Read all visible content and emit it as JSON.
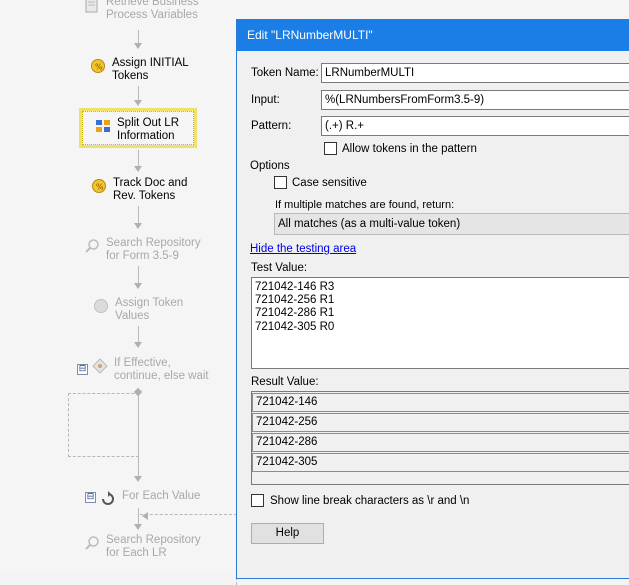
{
  "workflow": {
    "nodes": [
      {
        "label": "Retrieve Business\nProcess Variables",
        "icon": "document-icon"
      },
      {
        "label": "Assign INITIAL\nTokens",
        "icon": "token-icon"
      },
      {
        "label": "Split Out LR\nInformation",
        "icon": "grid-icon"
      },
      {
        "label": "Track Doc and\nRev. Tokens",
        "icon": "token-icon"
      },
      {
        "label": "Search Repository\nfor Form 3.5-9",
        "icon": "search-icon"
      },
      {
        "label": "Assign Token\nValues",
        "icon": "token-icon"
      },
      {
        "label": "If Effective,\ncontinue, else wait",
        "icon": "condition-icon"
      },
      {
        "label": "For Each Value",
        "icon": "loop-icon"
      },
      {
        "label": "Search Repository\nfor Each LR",
        "icon": "search-icon"
      }
    ],
    "collapse_symbol": "⊟"
  },
  "dialog": {
    "title": "Edit \"LRNumberMULTI\"",
    "token_name_label": "Token Name:",
    "token_name_value": "LRNumberMULTI",
    "input_label": "Input:",
    "input_value": "%(LRNumbersFromForm3.5-9)",
    "pattern_label": "Pattern:",
    "pattern_value": "(.+) R.+",
    "allow_tokens_label": "Allow tokens in the pattern",
    "allow_tokens_checked": false,
    "options_label": "Options",
    "case_sensitive_label": "Case sensitive",
    "case_sensitive_checked": false,
    "multiple_matches_label": "If multiple matches are found, return:",
    "multiple_matches_value": "All matches (as a multi-value token)",
    "hide_testing_link": "Hide the testing area",
    "test_value_label": "Test Value:",
    "test_value_lines": [
      "721042-146 R3",
      "721042-256 R1",
      "721042-286 R1",
      "721042-305 R0"
    ],
    "result_value_label": "Result Value:",
    "result_values": [
      "721042-146",
      "721042-256",
      "721042-286",
      "721042-305"
    ],
    "show_line_breaks_label": "Show line break characters as \\r and \\n",
    "show_line_breaks_checked": false,
    "help_button": "Help"
  }
}
